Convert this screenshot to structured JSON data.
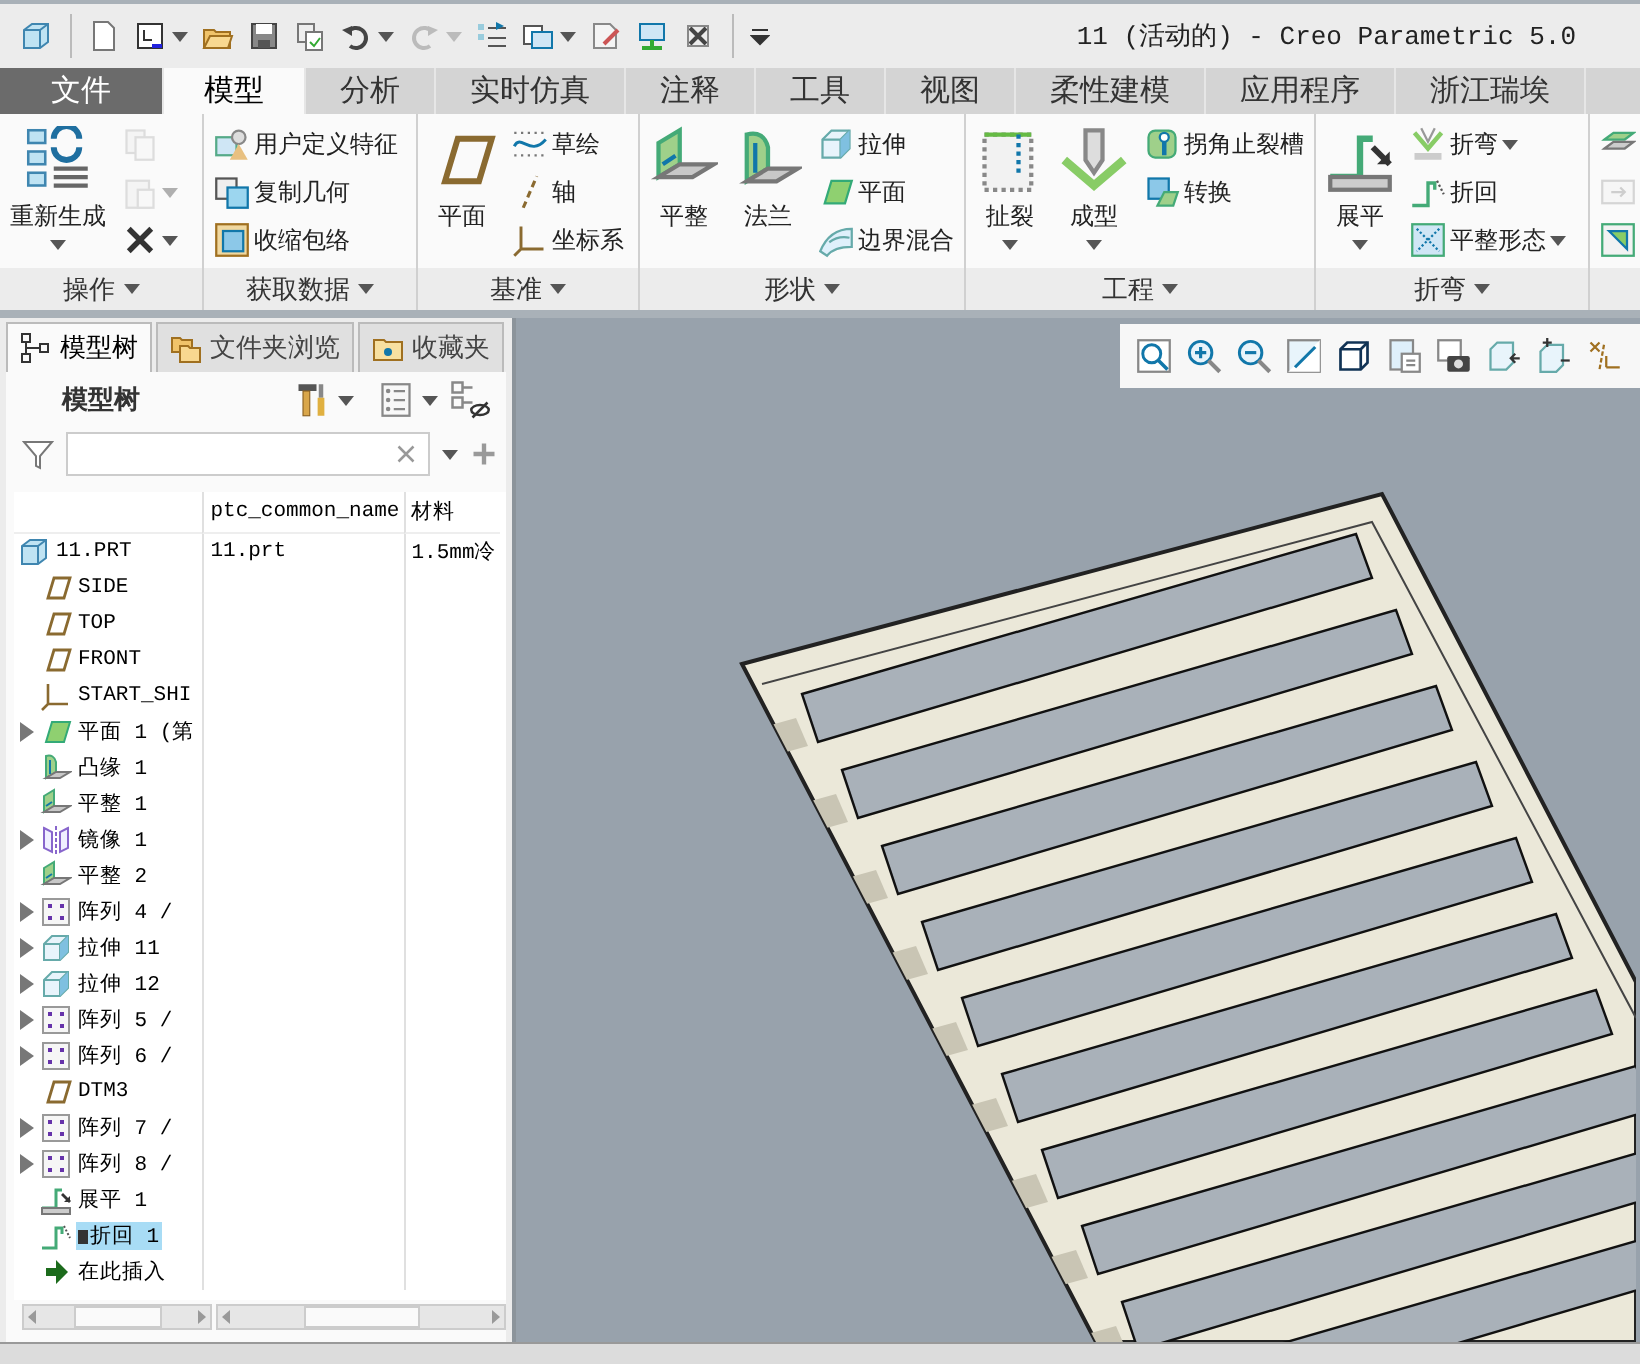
{
  "title_bar": {
    "title": "11 (活动的) - Creo Parametric 5.0"
  },
  "ribbon_tabs": [
    {
      "label": "文件",
      "kind": "file",
      "selected": false
    },
    {
      "label": "模型",
      "kind": "tab",
      "selected": true
    },
    {
      "label": "分析",
      "kind": "tab",
      "selected": false
    },
    {
      "label": "实时仿真",
      "kind": "tab",
      "selected": false
    },
    {
      "label": "注释",
      "kind": "tab",
      "selected": false
    },
    {
      "label": "工具",
      "kind": "tab",
      "selected": false
    },
    {
      "label": "视图",
      "kind": "tab",
      "selected": false
    },
    {
      "label": "柔性建模",
      "kind": "tab",
      "selected": false
    },
    {
      "label": "应用程序",
      "kind": "tab",
      "selected": false
    },
    {
      "label": "浙江瑞埃",
      "kind": "tab",
      "selected": false
    }
  ],
  "ribbon_groups": [
    {
      "label": "操作",
      "buttons": [
        {
          "label": "重新生成",
          "kind": "large",
          "dropdown": true,
          "disabled": false
        },
        {
          "kind": "small",
          "dropdown": false,
          "disabled": true
        },
        {
          "kind": "small",
          "dropdown": true,
          "disabled": true
        },
        {
          "kind": "small",
          "dropdown": true,
          "disabled": false
        }
      ]
    },
    {
      "label": "获取数据",
      "buttons": [
        {
          "label": "用户定义特征",
          "kind": "small",
          "dropdown": false,
          "disabled": false
        },
        {
          "label": "复制几何",
          "kind": "small",
          "dropdown": false,
          "disabled": false
        },
        {
          "label": "收缩包络",
          "kind": "small",
          "dropdown": false,
          "disabled": false
        }
      ]
    },
    {
      "label": "基准",
      "buttons": [
        {
          "label": "平面",
          "kind": "large",
          "dropdown": false,
          "disabled": false
        },
        {
          "label": "草绘",
          "kind": "small",
          "dropdown": false,
          "disabled": false
        },
        {
          "label": "轴",
          "kind": "small",
          "dropdown": false,
          "disabled": false
        },
        {
          "label": "坐标系",
          "kind": "small",
          "dropdown": false,
          "disabled": false
        }
      ]
    },
    {
      "label": "形状",
      "buttons": [
        {
          "label": "平整",
          "kind": "large",
          "dropdown": false,
          "disabled": false
        },
        {
          "label": "法兰",
          "kind": "large",
          "dropdown": false,
          "disabled": false
        },
        {
          "label": "拉伸",
          "kind": "small",
          "dropdown": false,
          "disabled": false
        },
        {
          "label": "平面",
          "kind": "small",
          "dropdown": false,
          "disabled": false
        },
        {
          "label": "边界混合",
          "kind": "small",
          "dropdown": false,
          "disabled": false
        }
      ]
    },
    {
      "label": "工程",
      "buttons": [
        {
          "label": "扯裂",
          "kind": "large",
          "dropdown": true,
          "disabled": false
        },
        {
          "label": "成型",
          "kind": "large",
          "dropdown": true,
          "disabled": false
        },
        {
          "label": "拐角止裂槽",
          "kind": "small",
          "dropdown": false,
          "disabled": false
        },
        {
          "label": "转换",
          "kind": "small",
          "dropdown": false,
          "disabled": false
        }
      ]
    },
    {
      "label": "折弯",
      "buttons": [
        {
          "label": "展平",
          "kind": "large",
          "dropdown": true,
          "disabled": false
        },
        {
          "label": "折弯",
          "kind": "small",
          "dropdown": true,
          "disabled": false
        },
        {
          "label": "折回",
          "kind": "small",
          "dropdown": false,
          "disabled": false
        },
        {
          "label": "平整形态",
          "kind": "small",
          "dropdown": true,
          "disabled": false
        }
      ]
    },
    {
      "buttons": [
        {
          "kind": "small",
          "dropdown": false,
          "disabled": false
        },
        {
          "kind": "small",
          "dropdown": false,
          "disabled": true
        },
        {
          "kind": "small",
          "dropdown": false,
          "disabled": false
        }
      ]
    }
  ],
  "model_tree": {
    "tabs": [
      {
        "label": "模型树",
        "selected": true
      },
      {
        "label": "文件夹浏览",
        "selected": false
      },
      {
        "label": "收藏夹",
        "selected": false
      }
    ],
    "heading": "模型树",
    "columns": [
      {
        "label": "ptc_common_name"
      },
      {
        "label": "材料"
      }
    ],
    "items": [
      {
        "name": "11.PRT",
        "kind": "part",
        "ptc_common_name": "11.prt",
        "material": "1.5mm冷",
        "selected": false,
        "expandable": false,
        "children": [
          {
            "name": "SIDE",
            "kind": "datum-plane",
            "selected": false,
            "expandable": false
          },
          {
            "name": "TOP",
            "kind": "datum-plane",
            "selected": false,
            "expandable": false
          },
          {
            "name": "FRONT",
            "kind": "datum-plane",
            "selected": false,
            "expandable": false
          },
          {
            "name": "START_SHI",
            "kind": "csys",
            "selected": false,
            "expandable": false
          },
          {
            "name": "平面 1 (第",
            "kind": "planar",
            "selected": false,
            "expandable": true
          },
          {
            "name": "凸缘 1",
            "kind": "flange",
            "selected": false,
            "expandable": false
          },
          {
            "name": "平整 1",
            "kind": "flat",
            "selected": false,
            "expandable": false
          },
          {
            "name": "镜像 1",
            "kind": "mirror",
            "selected": false,
            "expandable": true
          },
          {
            "name": "平整 2",
            "kind": "flat",
            "selected": false,
            "expandable": false
          },
          {
            "name": "阵列 4 /",
            "kind": "pattern",
            "selected": false,
            "expandable": true
          },
          {
            "name": "拉伸 11",
            "kind": "extrude",
            "selected": false,
            "expandable": true
          },
          {
            "name": "拉伸 12",
            "kind": "extrude",
            "selected": false,
            "expandable": true
          },
          {
            "name": "阵列 5 /",
            "kind": "pattern",
            "selected": false,
            "expandable": true
          },
          {
            "name": "阵列 6 /",
            "kind": "pattern",
            "selected": false,
            "expandable": true
          },
          {
            "name": "DTM3",
            "kind": "datum-plane",
            "selected": false,
            "expandable": false
          },
          {
            "name": "阵列 7 /",
            "kind": "pattern",
            "selected": false,
            "expandable": true
          },
          {
            "name": "阵列 8 /",
            "kind": "pattern",
            "selected": false,
            "expandable": true
          },
          {
            "name": "展平 1",
            "kind": "unbend",
            "selected": false,
            "expandable": false
          },
          {
            "name": "折回 1",
            "kind": "bendback",
            "selected": true,
            "expandable": false
          },
          {
            "name": "在此插入",
            "kind": "insert",
            "selected": false,
            "expandable": false
          }
        ]
      }
    ]
  }
}
